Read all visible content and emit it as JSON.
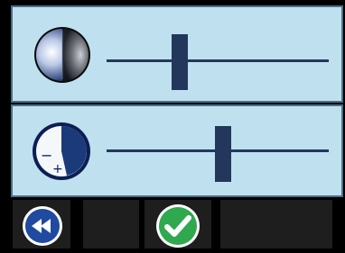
{
  "controls": [
    {
      "id": "brightness",
      "icon": "brightness-sphere-icon",
      "level": 0.33
    },
    {
      "id": "zoom",
      "icon": "zoom-moon-icon",
      "level": 0.51
    }
  ],
  "toolbar": {
    "buttons": [
      {
        "icon": "rewind-icon"
      },
      {
        "icon": "blank"
      },
      {
        "icon": "confirm-check-icon"
      },
      {
        "icon": "blank"
      }
    ]
  },
  "colors": {
    "panel": "#bfe0ee",
    "panel_border": "#4d6f86",
    "slider": "#23375c",
    "background": "#000000",
    "rewind_blue": "#1f4aa0",
    "check_green": "#2fa84f"
  }
}
